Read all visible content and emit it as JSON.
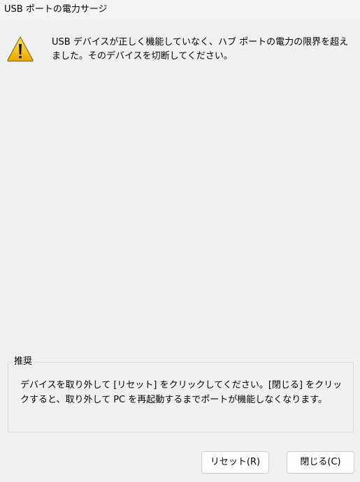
{
  "window": {
    "title": "USB ポートの電力サージ"
  },
  "message": {
    "icon": "warning-icon",
    "text": "USB デバイスが正しく機能していなく、ハブ ポートの電力の限界を超えました。そのデバイスを切断してください。"
  },
  "recommendation": {
    "title": "推奨",
    "text": "デバイスを取り外して [リセット] をクリックしてください。[閉じる] をクリックすると、取り外して PC を再起動するまでポートが機能しなくなります。"
  },
  "buttons": {
    "reset_label": "リセット(R)",
    "close_label": "閉じる(C)"
  },
  "colors": {
    "background": "#f0f0f0",
    "warning_fill": "#f5c400",
    "warning_outline": "#8a6d00"
  }
}
